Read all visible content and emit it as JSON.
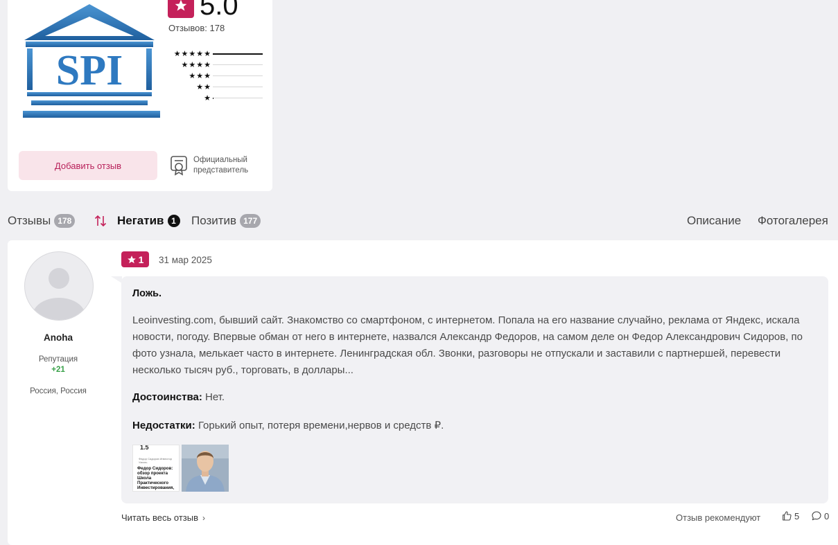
{
  "company": {
    "logo_text": "SPI",
    "rating_value": "5.0",
    "reviews_label": "Отзывов: 178",
    "distribution": [
      {
        "stars": "★★★★★",
        "fraction": 1.0
      },
      {
        "stars": "★★★★",
        "fraction": 0.0
      },
      {
        "stars": "★★★",
        "fraction": 0.0
      },
      {
        "stars": "★★",
        "fraction": 0.0
      },
      {
        "stars": "★",
        "fraction": 0.01
      }
    ],
    "add_review_label": "Добавить отзыв",
    "official_rep_label": "Официальный представитель"
  },
  "tabs": {
    "reviews_label": "Отзывы",
    "reviews_count": "178",
    "negative_label": "Негатив",
    "negative_count": "1",
    "positive_label": "Позитив",
    "positive_count": "177",
    "description_label": "Описание",
    "gallery_label": "Фотогалерея"
  },
  "review": {
    "author": "Anoha",
    "reputation_label": "Репутация",
    "reputation_value": "+21",
    "location": "Россия, Россия",
    "score": "1",
    "date": "31 мар 2025",
    "title": "Ложь.",
    "text": "Leoinvesting.com, бывший сайт. Знакомство со смартфоном, с интернетом. Попала на его название случайно, реклама от Яндекс, искала новости, погоду. Впервые обман от него в интернете, назвался Александр Федоров, на самом деле он Федор Александрович Сидоров, по фото узнала, мелькает часто в интернете. Ленинградская обл. Звонки, разговоры не отпускали и заставили с партнершей, перевести несколько тысяч руб., торговать, в доллары...",
    "pros_label": "Достоинства:",
    "pros_text": "Нет.",
    "cons_label": "Недостатки:",
    "cons_text": "Горький опыт, потеря времени,нервов и средств ₽.",
    "thumb1_top": "1.5",
    "thumb1_sub": "Федор Сидоров Инвестор Узнать",
    "thumb1_caption": "Федор Сидоров: обзор проекта Школа Практического Инвестирования, отзывы учеников",
    "read_more_label": "Читать весь отзыв",
    "recommend_label": "Отзыв рекомендуют",
    "likes": "5",
    "comments": "0"
  },
  "colors": {
    "accent": "#c4215a",
    "accent_light": "#f9e4ea",
    "logo_blue": "#2e79c0",
    "positive_green": "#3aa14a"
  }
}
